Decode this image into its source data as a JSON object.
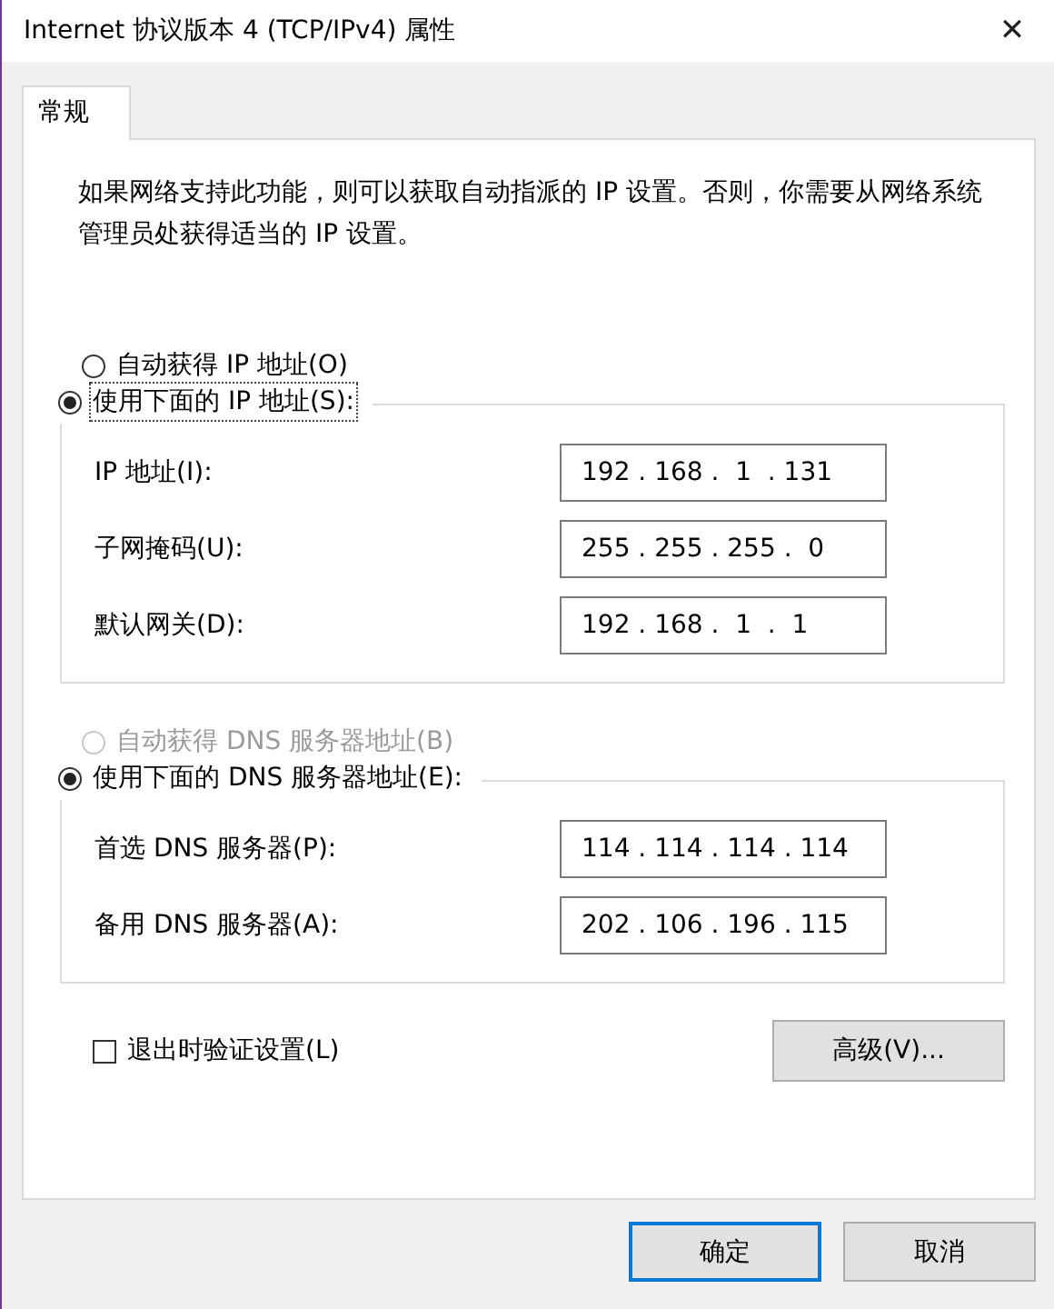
{
  "window": {
    "title": "Internet 协议版本 4 (TCP/IPv4) 属性",
    "close": "✕"
  },
  "tabs": [
    {
      "label": "常规",
      "selected": true
    }
  ],
  "description": "如果网络支持此功能，则可以获取自动指派的 IP 设置。否则，你需要从网络系统管理员处获得适当的 IP 设置。",
  "ip_section": {
    "auto": {
      "label": "自动获得 IP 地址(O)",
      "selected": false,
      "disabled": false
    },
    "manual": {
      "label": "使用下面的 IP 地址(S):",
      "selected": true,
      "disabled": false,
      "focused": true
    },
    "fields": [
      {
        "label": "IP 地址(I):",
        "value": "192 . 168 .  1  . 131"
      },
      {
        "label": "子网掩码(U):",
        "value": "255 . 255 . 255 .  0"
      },
      {
        "label": "默认网关(D):",
        "value": "192 . 168 .  1  .  1"
      }
    ]
  },
  "dns_section": {
    "auto": {
      "label": "自动获得 DNS 服务器地址(B)",
      "selected": false,
      "disabled": true
    },
    "manual": {
      "label": "使用下面的 DNS 服务器地址(E):",
      "selected": true,
      "disabled": false,
      "focused": false
    },
    "fields": [
      {
        "label": "首选 DNS 服务器(P):",
        "value": "114 . 114 . 114 . 114"
      },
      {
        "label": "备用 DNS 服务器(A):",
        "value": "202 . 106 . 196 . 115"
      }
    ]
  },
  "validate_checkbox": {
    "label": "退出时验证设置(L)",
    "checked": false
  },
  "advanced_button": "高级(V)...",
  "buttons": [
    {
      "label": "确定",
      "default": true
    },
    {
      "label": "取消",
      "default": false
    }
  ]
}
